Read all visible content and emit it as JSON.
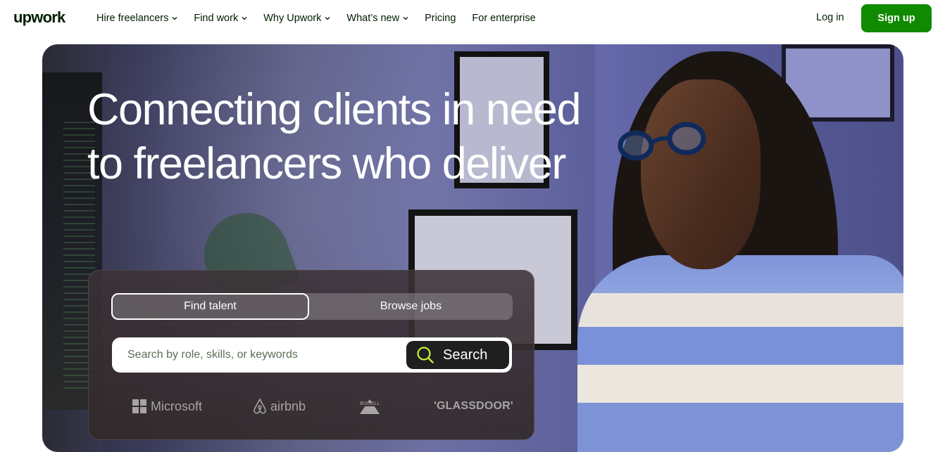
{
  "nav": {
    "logo": "upwork",
    "menu": [
      {
        "label": "Hire freelancers",
        "has_dropdown": true
      },
      {
        "label": "Find work",
        "has_dropdown": true
      },
      {
        "label": "Why Upwork",
        "has_dropdown": true
      },
      {
        "label": "What’s new",
        "has_dropdown": true
      },
      {
        "label": "Pricing",
        "has_dropdown": false
      },
      {
        "label": "For enterprise",
        "has_dropdown": false
      }
    ],
    "login": "Log in",
    "signup": "Sign up",
    "signup_color": "#108a00"
  },
  "hero": {
    "headline": "Connecting clients in need to freelancers who deliver",
    "tabs": {
      "active": "Find talent",
      "inactive": "Browse jobs"
    },
    "search": {
      "placeholder": "Search by role, skills, or keywords",
      "button": "Search",
      "icon": "search-icon",
      "icon_color": "#c6f23d"
    },
    "logos": [
      {
        "name": "Microsoft",
        "icon": "microsoft-icon"
      },
      {
        "name": "airbnb",
        "icon": "airbnb-icon"
      },
      {
        "name": "BISSELL",
        "icon": "bissell-icon"
      },
      {
        "name": "'GLASSDOOR'",
        "icon": "glassdoor-icon"
      }
    ]
  }
}
